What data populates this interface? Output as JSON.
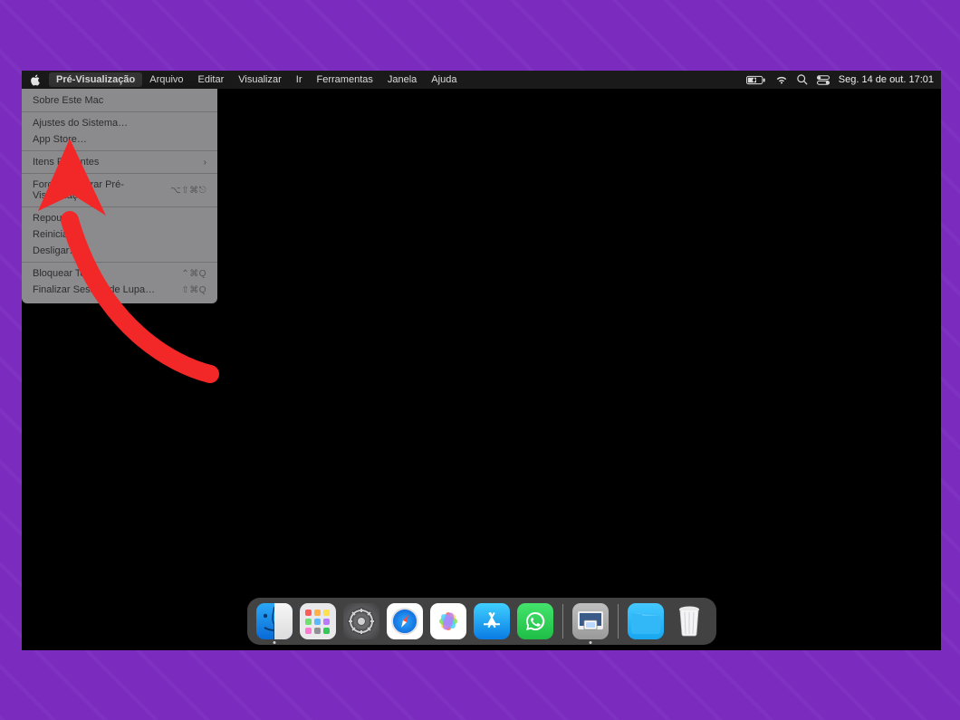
{
  "menubar": {
    "app_name": "Pré-Visualização",
    "items": [
      "Arquivo",
      "Editar",
      "Visualizar",
      "Ir",
      "Ferramentas",
      "Janela",
      "Ajuda"
    ],
    "clock": "Seg. 14 de out.  17:01"
  },
  "apple_menu": {
    "about": "Sobre Este Mac",
    "system_settings": "Ajustes do Sistema…",
    "app_store": "App Store…",
    "recent_items": "Itens Recentes",
    "force_quit": "Forçar Encerrar Pré-Visualização",
    "force_quit_shortcut": "⌥⇧⌘⎋",
    "sleep": "Repouso",
    "restart": "Reiniciar…",
    "shutdown": "Desligar…",
    "lock_screen": "Bloquear Tela",
    "lock_screen_shortcut": "⌃⌘Q",
    "log_out": "Finalizar Sessão de Lupa…",
    "log_out_shortcut": "⇧⌘Q"
  },
  "dock": {
    "items": [
      "Finder",
      "Launchpad",
      "Ajustes do Sistema",
      "Safari",
      "Fotos",
      "App Store",
      "WhatsApp",
      "Pré-Visualização",
      "Downloads",
      "Lixo"
    ]
  },
  "annotation": {
    "type": "arrow",
    "color": "#f22828",
    "target": "Ajustes do Sistema…"
  }
}
